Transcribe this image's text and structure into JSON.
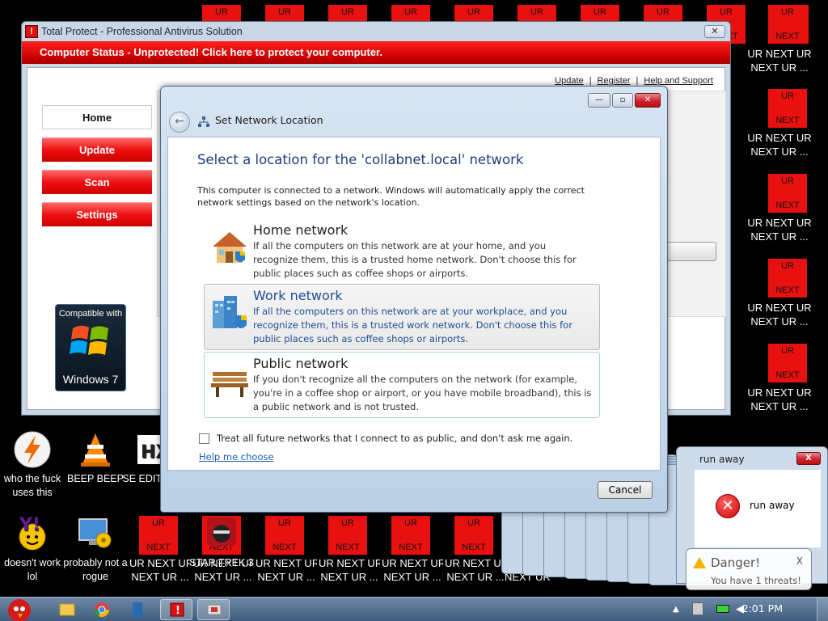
{
  "desktop": {
    "tile_top": "UR",
    "tile_bottom": "NEXT",
    "spam_line1": "UR NEXT UR",
    "spam_line2": "NEXT UR ...",
    "icons": [
      {
        "label": "who the fuck uses this"
      },
      {
        "label": "BEEP BEEP"
      },
      {
        "label": "SE EDIT"
      },
      {
        "label": "doesn't work lol"
      },
      {
        "label": "probably not a rogue"
      },
      {
        "label": "STAR TREK 3"
      }
    ]
  },
  "total_protect": {
    "title": "Total Protect - Professional Antivirus Solution",
    "close_glyph": "✕",
    "status": "Computer Status - Unprotected! Click here to protect your computer.",
    "links": [
      "Update",
      "Register",
      "Help and Support"
    ],
    "nav": [
      "Home",
      "Update",
      "Scan",
      "Settings"
    ],
    "badge_top": "Compatible with",
    "badge_bottom": "Windows 7"
  },
  "set_network": {
    "title": "Set Network Location",
    "heading": "Select a location for the 'collabnet.local' network",
    "intro": "This computer is connected to a network. Windows will automatically apply the correct network settings based on the network's location.",
    "options": [
      {
        "title": "Home network",
        "desc": "If all the computers on this network are at your home, and you recognize them, this is a trusted home network.  Don't choose this for public places such as coffee shops or airports."
      },
      {
        "title": "Work network",
        "desc": "If all the computers on this network are at your workplace, and you recognize them, this is a trusted work network.  Don't choose this for public places such as coffee shops or airports."
      },
      {
        "title": "Public network",
        "desc": "If you don't recognize all the computers on the network (for example, you're in a coffee shop or airport, or you have mobile broadband), this is a public network and is not trusted."
      }
    ],
    "checkbox_label": "Treat all future networks that I connect to as public, and don't ask me again.",
    "help_link": "Help me choose",
    "cancel": "Cancel"
  },
  "run_away": {
    "title": "run away",
    "message": "run away",
    "close_glyph": "X"
  },
  "danger": {
    "title": "Danger!",
    "subtitle": "You have 1 threats!",
    "close_glyph": "X"
  },
  "taskbar": {
    "clock": "2:01 PM"
  }
}
